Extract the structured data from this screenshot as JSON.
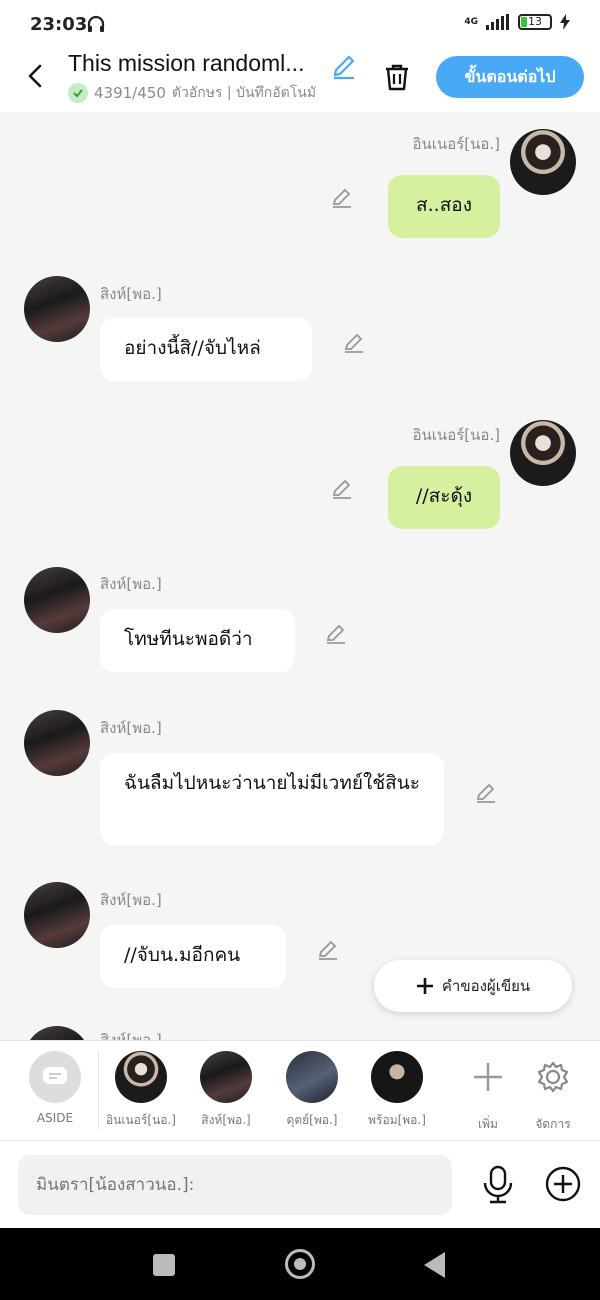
{
  "status_bar": {
    "time": "23:03",
    "network": "4G",
    "battery": "13"
  },
  "header": {
    "title": "This mission randoml...",
    "char_count": "4391/450",
    "char_unit": "ตัวอักษร | บันทึกอัตโนมั",
    "next_button": "ขั้นตอนต่อไป"
  },
  "messages": [
    {
      "side": "right",
      "sender": "อินเนอร์[นอ.]",
      "text": "ส..สอง"
    },
    {
      "side": "left",
      "sender": "สิงห์[พอ.]",
      "text": "อย่างนี้สิ//จับไหล่"
    },
    {
      "side": "right",
      "sender": "อินเนอร์[นอ.]",
      "text": "//สะดุ้ง"
    },
    {
      "side": "left",
      "sender": "สิงห์[พอ.]",
      "text": "โทษทีนะพอดีว่า"
    },
    {
      "side": "left",
      "sender": "สิงห์[พอ.]",
      "text": "ฉันลืมไปหนะว่านายไม่มีเวทย์ใช้สินะ"
    },
    {
      "side": "left",
      "sender": "สิงห์[พอ.]",
      "text": "//จับน.มอีกคน"
    },
    {
      "side": "left",
      "sender": "สิงห์[พอ.]",
      "text": ""
    }
  ],
  "fab": {
    "label": "คำของผู้เขียน"
  },
  "characters": [
    {
      "label": "ASIDE"
    },
    {
      "label": "อินเนอร์[นอ.]"
    },
    {
      "label": "สิงห์[พอ.]"
    },
    {
      "label": "ดุตย์[พอ.]"
    },
    {
      "label": "พร้อม[พอ.]"
    },
    {
      "label": "เพิ่ม"
    },
    {
      "label": "จัดการ"
    }
  ],
  "input": {
    "placeholder": "มินตรา[น้องสาวนอ.]:"
  },
  "colors": {
    "accent": "#4aa9f5",
    "my_bubble": "#d6f0a0",
    "other_bubble": "#ffffff"
  }
}
